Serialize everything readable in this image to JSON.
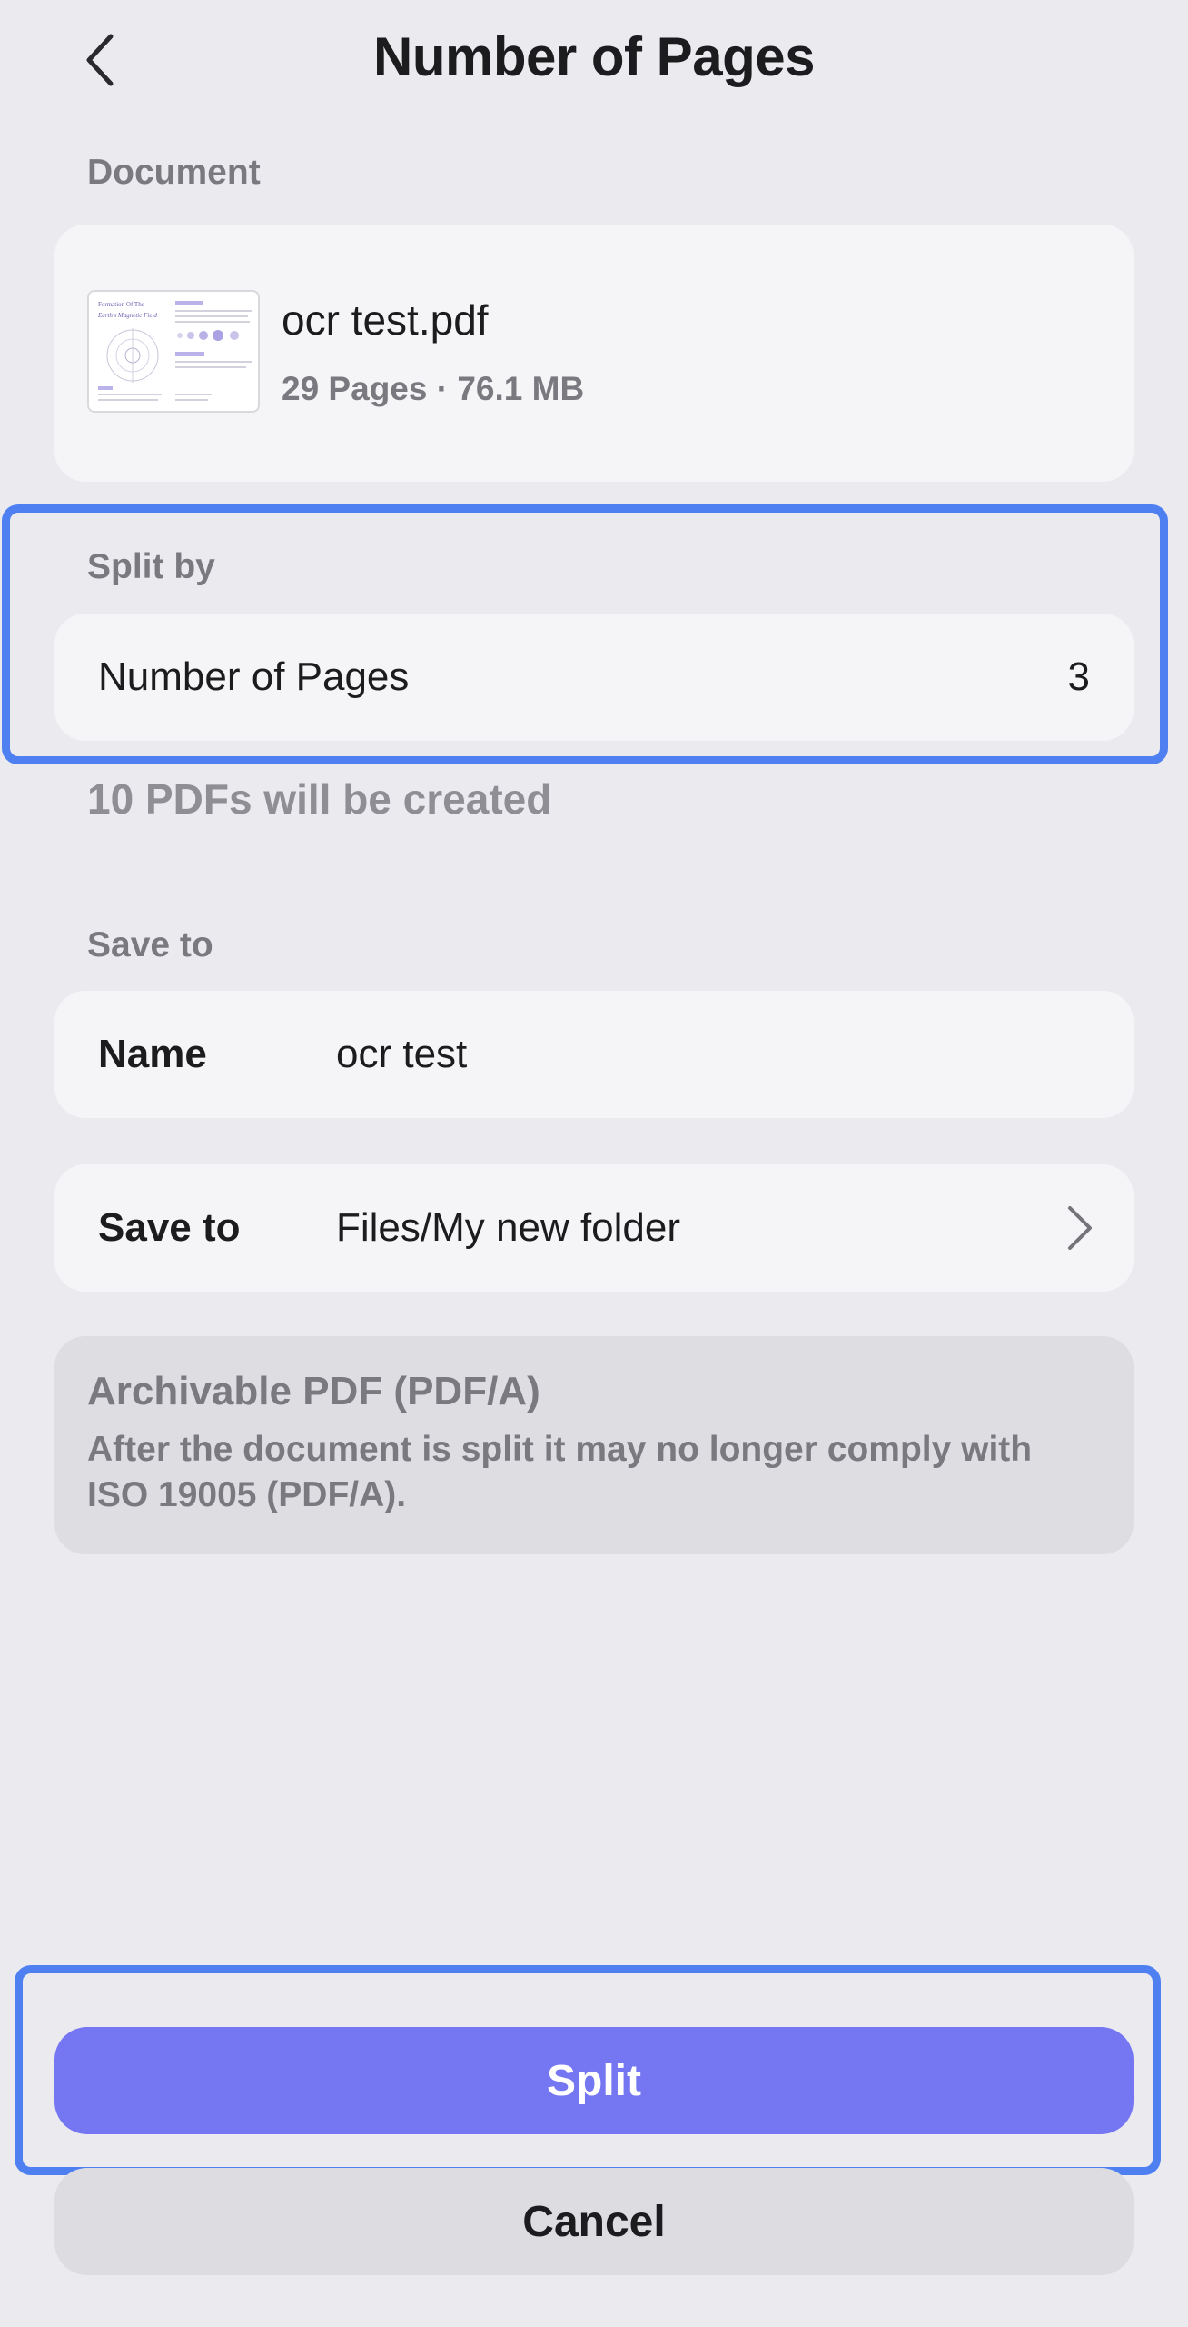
{
  "header": {
    "title": "Number of Pages",
    "back_icon": "chevron-left-icon"
  },
  "document": {
    "section_label": "Document",
    "file_name": "ocr test.pdf",
    "meta": "29 Pages · 76.1 MB",
    "thumbnail_title_line1": "Formation Of The",
    "thumbnail_title_line2": "Earth's Magnetic Field"
  },
  "split_by": {
    "section_label": "Split by",
    "label": "Number of Pages",
    "value": "3",
    "result_note": "10 PDFs will be created"
  },
  "save": {
    "section_label": "Save to",
    "name_label": "Name",
    "name_value": "ocr test",
    "location_label": "Save to",
    "location_value": "Files/My new folder",
    "location_icon": "chevron-right-icon"
  },
  "pdfa": {
    "title": "Archivable PDF (PDF/A)",
    "text": "After the document is split it may no longer comply with ISO 19005 (PDF/A)."
  },
  "actions": {
    "split_label": "Split",
    "cancel_label": "Cancel"
  },
  "colors": {
    "background": "#ebeaee",
    "card": "#f5f4f7",
    "accent": "#7576f1",
    "highlight": "#4f80f2"
  }
}
